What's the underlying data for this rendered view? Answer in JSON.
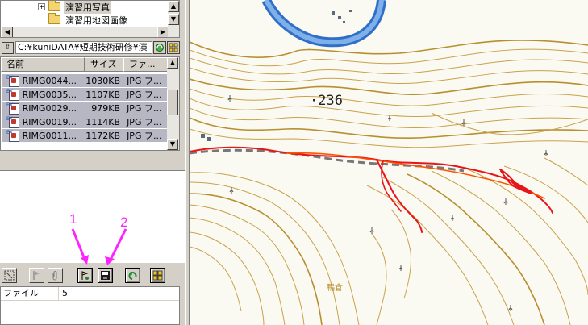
{
  "tree": {
    "items": [
      {
        "label": "演習用写真",
        "expander": "+",
        "selected": true
      },
      {
        "label": "演習用地図画像",
        "expander": "",
        "selected": false
      }
    ]
  },
  "pathbar": {
    "path": "C:¥kuniDATA¥短期技術研修¥演"
  },
  "filelist": {
    "columns": [
      "名前",
      "サイズ",
      "ファ..."
    ],
    "rows": [
      {
        "name": "RIMG0044...",
        "size": "1030KB",
        "type": "JPG フ..."
      },
      {
        "name": "RIMG0035...",
        "size": "1107KB",
        "type": "JPG フ..."
      },
      {
        "name": "RIMG0029...",
        "size": "979KB",
        "type": "JPG フ..."
      },
      {
        "name": "RIMG0019...",
        "size": "1114KB",
        "type": "JPG フ..."
      },
      {
        "name": "RIMG0011...",
        "size": "1172KB",
        "type": "JPG フ..."
      }
    ]
  },
  "annotations": {
    "label1": "1",
    "label2": "2",
    "color": "#ff22ff"
  },
  "properties": {
    "rows": [
      {
        "key": "ファイル",
        "value": "5"
      }
    ]
  },
  "map": {
    "elevation_label": "·236",
    "spot_label": "鴨倉",
    "track_color": "#e8141a",
    "contour_color": "#c8a24c",
    "river_color": "#2f6fc8"
  },
  "toolbar_icons": [
    "select-icon",
    "flag-icon",
    "paperclip-icon",
    "map-pin-icon",
    "save-icon",
    "undo-icon",
    "grid-icon"
  ]
}
